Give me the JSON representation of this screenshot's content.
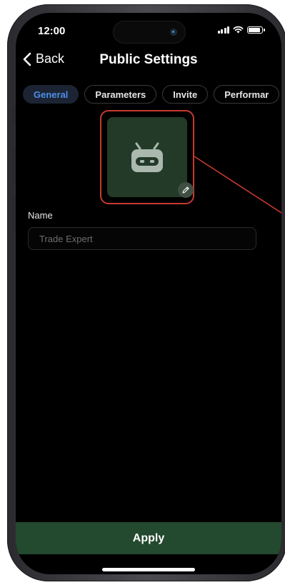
{
  "status_bar": {
    "time": "12:00",
    "icons": [
      "signal-icon",
      "wifi-icon",
      "battery-icon"
    ]
  },
  "nav": {
    "back_label": "Back",
    "title": "Public Settings"
  },
  "tabs": [
    {
      "label": "General",
      "active": true
    },
    {
      "label": "Parameters",
      "active": false
    },
    {
      "label": "Invite",
      "active": false
    },
    {
      "label": "Performar",
      "active": false
    }
  ],
  "avatar": {
    "icon": "robot-icon",
    "edit_icon": "pencil-icon"
  },
  "name_field": {
    "label": "Name",
    "placeholder": "Trade Expert",
    "value": ""
  },
  "apply_label": "Apply",
  "colors": {
    "background": "#000000",
    "accent_blue": "#4e8ee8",
    "active_tab_bg": "#1c2434",
    "avatar_bg": "#233a29",
    "highlight_red": "#c7392f",
    "apply_bg": "#23492e"
  }
}
